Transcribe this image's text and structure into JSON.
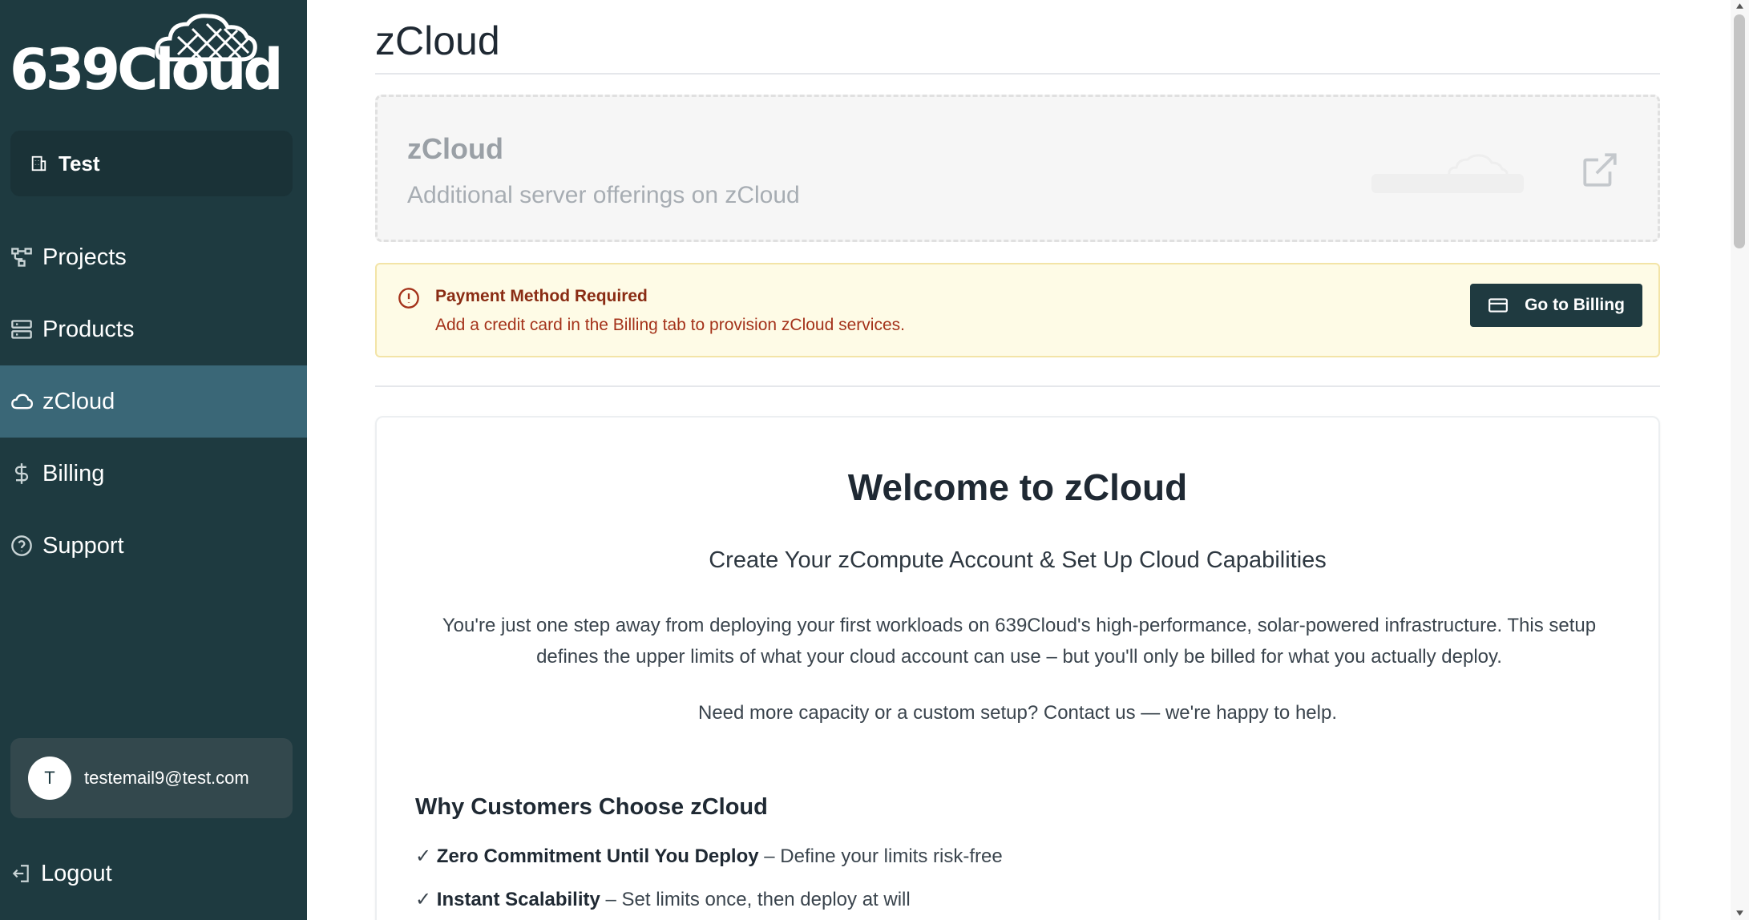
{
  "brand": {
    "logo_text": "639Cloud"
  },
  "sidebar": {
    "org_label": "Test",
    "items": [
      {
        "label": "Projects",
        "icon": "projects-icon"
      },
      {
        "label": "Products",
        "icon": "server-icon"
      },
      {
        "label": "zCloud",
        "icon": "cloud-icon",
        "active": true
      },
      {
        "label": "Billing",
        "icon": "dollar-icon"
      },
      {
        "label": "Support",
        "icon": "help-icon"
      }
    ],
    "user": {
      "avatar_initial": "T",
      "email": "testemail9@test.com"
    },
    "logout_label": "Logout"
  },
  "page": {
    "title": "zCloud"
  },
  "product_card": {
    "name": "zCloud",
    "description": "Additional server offerings on zCloud"
  },
  "alert": {
    "title": "Payment Method Required",
    "message": "Add a credit card in the Billing tab to provision zCloud services.",
    "button_label": "Go to Billing"
  },
  "welcome": {
    "title": "Welcome to zCloud",
    "subtitle": "Create Your zCompute Account & Set Up Cloud Capabilities",
    "body": "You're just one step away from deploying your first workloads on 639Cloud's high-performance, solar-powered infrastructure. This setup defines the upper limits of what your cloud account can use – but you'll only be billed for what you actually deploy.",
    "help": "Need more capacity or a custom setup? Contact us — we're happy to help.",
    "why_title": "Why Customers Choose zCloud",
    "benefits": [
      {
        "check": "✓",
        "strong": "Zero Commitment Until You Deploy",
        "rest": " – Define your limits risk-free"
      },
      {
        "check": "✓",
        "strong": "Instant Scalability",
        "rest": " – Set limits once, then deploy at will"
      }
    ]
  },
  "colors": {
    "sidebar_bg": "#1e3a40",
    "sidebar_active": "#3a6777",
    "alert_bg": "#fefbe6",
    "alert_text": "#a4321a",
    "primary_button": "#1f3a40"
  }
}
